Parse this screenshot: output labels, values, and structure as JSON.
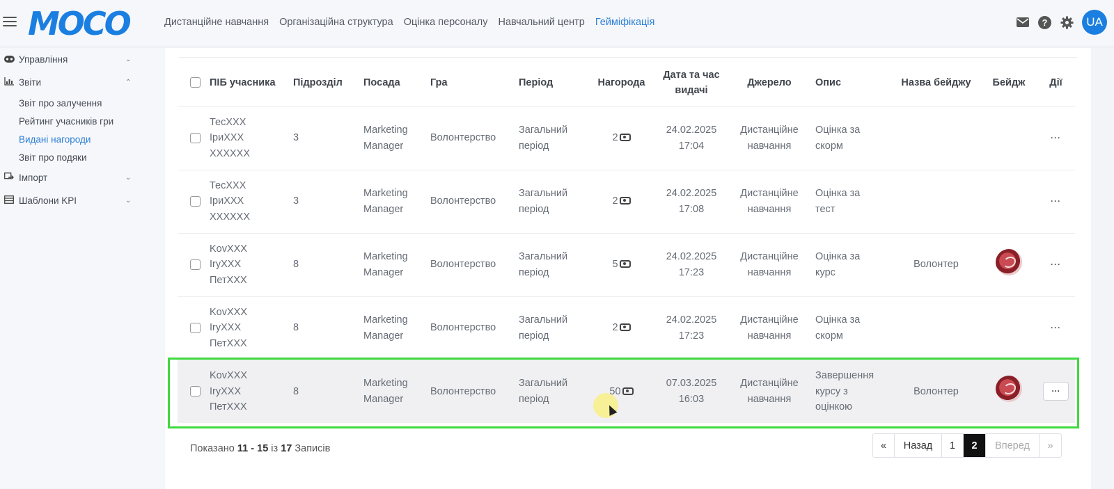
{
  "header": {
    "logo": "MOCO",
    "nav": [
      {
        "label": "Дистанційне навчання",
        "active": false
      },
      {
        "label": "Організаційна структура",
        "active": false
      },
      {
        "label": "Оцінка персоналу",
        "active": false
      },
      {
        "label": "Навчальний центр",
        "active": false
      },
      {
        "label": "Гейміфікація",
        "active": true
      }
    ],
    "help": "?",
    "avatar": "UA",
    "accent": "#1a7fe0"
  },
  "sidebar": {
    "groups": [
      {
        "label": "Управління",
        "icon": "gamepad-icon"
      },
      {
        "label": "Звіти",
        "icon": "chart-icon"
      },
      {
        "label": "Імпорт",
        "icon": "import-icon"
      },
      {
        "label": "Шаблони KPI",
        "icon": "template-icon"
      }
    ],
    "report_items": [
      {
        "label": "Звіт про залучення"
      },
      {
        "label": "Рейтинг учасників гри"
      },
      {
        "label": "Видані нагороди",
        "active": true
      },
      {
        "label": "Звіт про подяки"
      }
    ]
  },
  "table": {
    "columns": [
      "ПІБ учасника",
      "Підрозділ",
      "Посада",
      "Гра",
      "Період",
      "Нагорода",
      "Дата та час видачі",
      "Джерело",
      "Опис",
      "Назва бейджу",
      "Бейдж",
      "Дії"
    ],
    "rows": [
      {
        "name": [
          "ТесХХХ",
          "ІриХХХ",
          "ХХХХХХ"
        ],
        "dept": "3",
        "position": [
          "Marketing",
          "Manager"
        ],
        "game": "Волонтерство",
        "period": [
          "Загальний",
          "період"
        ],
        "reward": "2",
        "date": "24.02.2025",
        "time": "17:04",
        "source": [
          "Дистанційне",
          "навчання"
        ],
        "desc": [
          "Оцінка за",
          "скорм"
        ],
        "badge_name": "",
        "has_badge": false
      },
      {
        "name": [
          "ТесХХХ",
          "ІриХХХ",
          "ХХХХХХ"
        ],
        "dept": "3",
        "position": [
          "Marketing",
          "Manager"
        ],
        "game": "Волонтерство",
        "period": [
          "Загальний",
          "період"
        ],
        "reward": "2",
        "date": "24.02.2025",
        "time": "17:08",
        "source": [
          "Дистанційне",
          "навчання"
        ],
        "desc": [
          "Оцінка за",
          "тест"
        ],
        "badge_name": "",
        "has_badge": false
      },
      {
        "name": [
          "KovXXX",
          "IryXXX",
          "ПетХХХ"
        ],
        "dept": "8",
        "position": [
          "Marketing",
          "Manager"
        ],
        "game": "Волонтерство",
        "period": [
          "Загальний",
          "період"
        ],
        "reward": "5",
        "date": "24.02.2025",
        "time": "17:23",
        "source": [
          "Дистанційне",
          "навчання"
        ],
        "desc": [
          "Оцінка за",
          "курс"
        ],
        "badge_name": "Волонтер",
        "has_badge": true
      },
      {
        "name": [
          "KovXXX",
          "IryXXX",
          "ПетХХХ"
        ],
        "dept": "8",
        "position": [
          "Marketing",
          "Manager"
        ],
        "game": "Волонтерство",
        "period": [
          "Загальний",
          "період"
        ],
        "reward": "2",
        "date": "24.02.2025",
        "time": "17:23",
        "source": [
          "Дистанційне",
          "навчання"
        ],
        "desc": [
          "Оцінка за",
          "скорм"
        ],
        "badge_name": "",
        "has_badge": false
      },
      {
        "name": [
          "KovXXX",
          "IryXXX",
          "ПетХХХ"
        ],
        "dept": "8",
        "position": [
          "Marketing",
          "Manager"
        ],
        "game": "Волонтерство",
        "period": [
          "Загальний",
          "період"
        ],
        "reward": "50",
        "date": "07.03.2025",
        "time": "16:03",
        "source": [
          "Дистанційне",
          "навчання"
        ],
        "desc": [
          "Завершення",
          "курсу з",
          "оцінкою"
        ],
        "badge_name": "Волонтер",
        "has_badge": true,
        "highlighted": true
      }
    ],
    "actions_label": "···"
  },
  "footer": {
    "prefix": "Показано",
    "from": "11",
    "dash": "-",
    "to": "15",
    "of": "із",
    "total": "17",
    "suffix": "Записів"
  },
  "pagination": {
    "first": "«",
    "prev": "Назад",
    "pages": [
      "1",
      "2"
    ],
    "current": "2",
    "next": "Вперед",
    "last": "»"
  }
}
